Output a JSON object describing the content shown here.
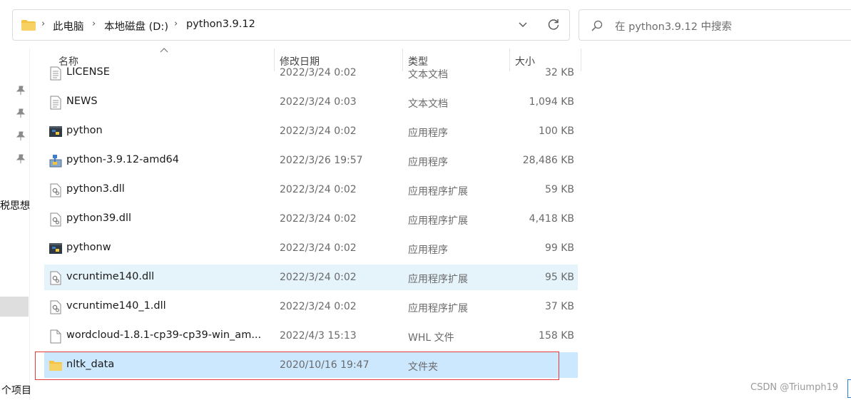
{
  "address": {
    "crumbs": [
      "此电脑",
      "本地磁盘 (D:)",
      "python3.9.12"
    ]
  },
  "search": {
    "placeholder": "在 python3.9.12 中搜索"
  },
  "nav": {
    "partial_label": "税思想",
    "status": "个项目"
  },
  "columns": {
    "name": "名称",
    "date": "修改日期",
    "type": "类型",
    "size": "大小"
  },
  "files": [
    {
      "name": "LICENSE",
      "date": "2022/3/24 0:02",
      "type": "文本文档",
      "size": "32 KB",
      "icon": "text-file-icon"
    },
    {
      "name": "NEWS",
      "date": "2022/3/24 0:03",
      "type": "文本文档",
      "size": "1,094 KB",
      "icon": "text-file-icon"
    },
    {
      "name": "python",
      "date": "2022/3/24 0:02",
      "type": "应用程序",
      "size": "100 KB",
      "icon": "python-exe-icon"
    },
    {
      "name": "python-3.9.12-amd64",
      "date": "2022/3/26 19:57",
      "type": "应用程序",
      "size": "28,486 KB",
      "icon": "installer-icon"
    },
    {
      "name": "python3.dll",
      "date": "2022/3/24 0:02",
      "type": "应用程序扩展",
      "size": "59 KB",
      "icon": "dll-file-icon"
    },
    {
      "name": "python39.dll",
      "date": "2022/3/24 0:02",
      "type": "应用程序扩展",
      "size": "4,418 KB",
      "icon": "dll-file-icon"
    },
    {
      "name": "pythonw",
      "date": "2022/3/24 0:02",
      "type": "应用程序",
      "size": "99 KB",
      "icon": "python-exe-icon"
    },
    {
      "name": "vcruntime140.dll",
      "date": "2022/3/24 0:02",
      "type": "应用程序扩展",
      "size": "95 KB",
      "icon": "dll-file-icon",
      "state": "hover"
    },
    {
      "name": "vcruntime140_1.dll",
      "date": "2022/3/24 0:02",
      "type": "应用程序扩展",
      "size": "37 KB",
      "icon": "dll-file-icon"
    },
    {
      "name": "wordcloud-1.8.1-cp39-cp39-win_am...",
      "date": "2022/4/3 15:13",
      "type": "WHL 文件",
      "size": "158 KB",
      "icon": "blank-file-icon"
    },
    {
      "name": "nltk_data",
      "date": "2020/10/16 19:47",
      "type": "文件夹",
      "size": "",
      "icon": "folder-icon",
      "state": "selected"
    }
  ],
  "watermark": "CSDN @Triumph19",
  "colors": {
    "selected_row": "#cce8ff",
    "hover_row": "#e5f3fb",
    "highlight_box": "#e0393e",
    "folder": "#f5c242"
  }
}
